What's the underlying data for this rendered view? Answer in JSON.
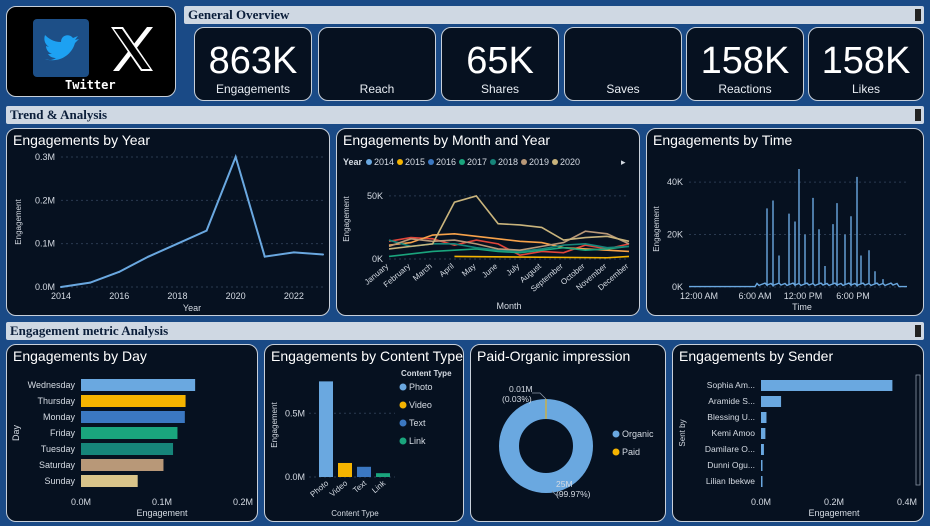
{
  "logo": {
    "brand_label": "Twitter",
    "x_glyph": "𝕏"
  },
  "sections": {
    "overview": "General Overview",
    "trend": "Trend & Analysis",
    "metric": "Engagement metric Analysis"
  },
  "kpis": [
    {
      "value": "863K",
      "label": "Engagements"
    },
    {
      "value": "",
      "label": "Reach"
    },
    {
      "value": "65K",
      "label": "Shares"
    },
    {
      "value": "",
      "label": "Saves"
    },
    {
      "value": "158K",
      "label": "Reactions"
    },
    {
      "value": "158K",
      "label": "Likes"
    }
  ],
  "colors": {
    "bar": "#6aa8e0",
    "accent": "#1a4a86"
  },
  "chart_data": [
    {
      "id": "by_year",
      "type": "line",
      "title": "Engagements by Year",
      "xlabel": "Year",
      "ylabel": "Engagement",
      "x": [
        2014,
        2015,
        2016,
        2017,
        2018,
        2019,
        2020,
        2021,
        2022,
        2023
      ],
      "values": [
        0.0,
        0.01,
        0.035,
        0.07,
        0.1,
        0.13,
        0.3,
        0.07,
        0.08,
        0.075
      ],
      "xticks": [
        "2014",
        "2016",
        "2018",
        "2020",
        "2022"
      ],
      "yticks": [
        "0.0M",
        "0.1M",
        "0.2M",
        "0.3M"
      ],
      "ylim": [
        0,
        0.3
      ]
    },
    {
      "id": "by_month",
      "type": "line",
      "title": "Engagements by Month and Year",
      "xlabel": "Month",
      "ylabel": "Engagement",
      "legend_title": "Year",
      "categories": [
        "January",
        "February",
        "March",
        "April",
        "May",
        "June",
        "July",
        "August",
        "September",
        "October",
        "November",
        "December"
      ],
      "yticks": [
        "0K",
        "50K"
      ],
      "ylim": [
        0,
        65000
      ],
      "series": [
        {
          "name": "2014",
          "color": "#6aa8e0",
          "values": [
            null,
            null,
            null,
            null,
            null,
            null,
            null,
            null,
            null,
            null,
            null,
            null
          ]
        },
        {
          "name": "2015",
          "color": "#f5b400",
          "values": [
            null,
            null,
            null,
            2000,
            null,
            null,
            null,
            null,
            null,
            null,
            1000,
            2000
          ]
        },
        {
          "name": "2016",
          "color": "#3b78c2",
          "values": [
            null,
            null,
            null,
            null,
            null,
            null,
            null,
            null,
            null,
            null,
            null,
            null
          ]
        },
        {
          "name": "2017",
          "color": "#1aa57d",
          "values": [
            2000,
            4000,
            6000,
            7000,
            8000,
            6000,
            5000,
            7000,
            9000,
            7000,
            8000,
            10000
          ]
        },
        {
          "name": "2018",
          "color": "#16857a",
          "values": [
            15000,
            10000,
            12000,
            12000,
            9000,
            7000,
            6000,
            8000,
            11000,
            12000,
            9000,
            10000
          ]
        },
        {
          "name": "2019",
          "color": "#b89878",
          "values": [
            10000,
            16000,
            14000,
            15000,
            12000,
            8000,
            7000,
            10000,
            13000,
            22000,
            20000,
            12000
          ]
        },
        {
          "name": "2020",
          "color": "#c9b47c",
          "values": [
            8000,
            10000,
            12000,
            45000,
            50000,
            28000,
            27000,
            25000,
            15000,
            17000,
            18000,
            14000
          ]
        }
      ],
      "extra_series": [
        {
          "color": "#e0453a",
          "values": [
            14000,
            17000,
            16000,
            11000,
            15000,
            12000,
            3000,
            6000,
            5000,
            11000,
            8000,
            12000
          ]
        },
        {
          "color": "#f7a24a",
          "values": [
            11000,
            13000,
            19000,
            20000,
            18000,
            16000,
            14000,
            13000,
            9000,
            8000,
            7000,
            6000
          ]
        }
      ]
    },
    {
      "id": "by_time",
      "type": "line",
      "title": "Engagements by Time",
      "xlabel": "Time",
      "ylabel": "Engagement",
      "xticks": [
        "12:00 AM",
        "6:00 AM",
        "12:00 PM",
        "6:00 PM"
      ],
      "yticks": [
        "0K",
        "20K",
        "40K"
      ],
      "ylim": [
        0,
        45000
      ]
    },
    {
      "id": "by_day",
      "type": "bar",
      "title": "Engagements by Day",
      "xlabel": "Engagement",
      "ylabel": "Day",
      "categories": [
        "Wednesday",
        "Thursday",
        "Monday",
        "Friday",
        "Tuesday",
        "Saturday",
        "Sunday"
      ],
      "values": [
        0.155,
        0.142,
        0.141,
        0.131,
        0.125,
        0.112,
        0.077
      ],
      "colors": [
        "#6aa8e0",
        "#f5b400",
        "#3b78c2",
        "#1aa57d",
        "#16857a",
        "#b89878",
        "#d9c48a"
      ],
      "xticks": [
        "0.0M",
        "0.1M",
        "0.2M"
      ],
      "xlim": [
        0,
        0.22
      ]
    },
    {
      "id": "by_content",
      "type": "bar",
      "title": "Engagements by Content Type",
      "xlabel": "Content Type",
      "ylabel": "Engagement",
      "legend_title": "Content Type",
      "categories": [
        "Photo",
        "Video",
        "Text",
        "Link"
      ],
      "values": [
        0.75,
        0.11,
        0.08,
        0.03
      ],
      "colors": [
        "#6aa8e0",
        "#f5b400",
        "#3b78c2",
        "#1aa57d"
      ],
      "yticks": [
        "0.0M",
        "0.5M"
      ],
      "ylim": [
        0,
        0.8
      ]
    },
    {
      "id": "paid_organic",
      "type": "pie",
      "title": "Paid-Organic impression",
      "slices": [
        {
          "name": "Organic",
          "value": 25,
          "label": "25M",
          "pct": "(99.97%)",
          "color": "#6aa8e0"
        },
        {
          "name": "Paid",
          "value": 0.01,
          "label": "0.01M",
          "pct": "(0.03%)",
          "color": "#f5b400"
        }
      ]
    },
    {
      "id": "by_sender",
      "type": "bar",
      "title": "Engagements by Sender",
      "xlabel": "Engagement",
      "ylabel": "Sent by",
      "categories": [
        "Sophia Am...",
        "Aramide S...",
        "Blessing U...",
        "Kemi Amoo",
        "Damilare O...",
        "Dunni Ogu...",
        "Lilian Ibekwe"
      ],
      "values": [
        0.36,
        0.055,
        0.015,
        0.012,
        0.008,
        0.004,
        0.002
      ],
      "xticks": [
        "0.0M",
        "0.2M",
        "0.4M"
      ],
      "xlim": [
        0,
        0.4
      ]
    }
  ]
}
